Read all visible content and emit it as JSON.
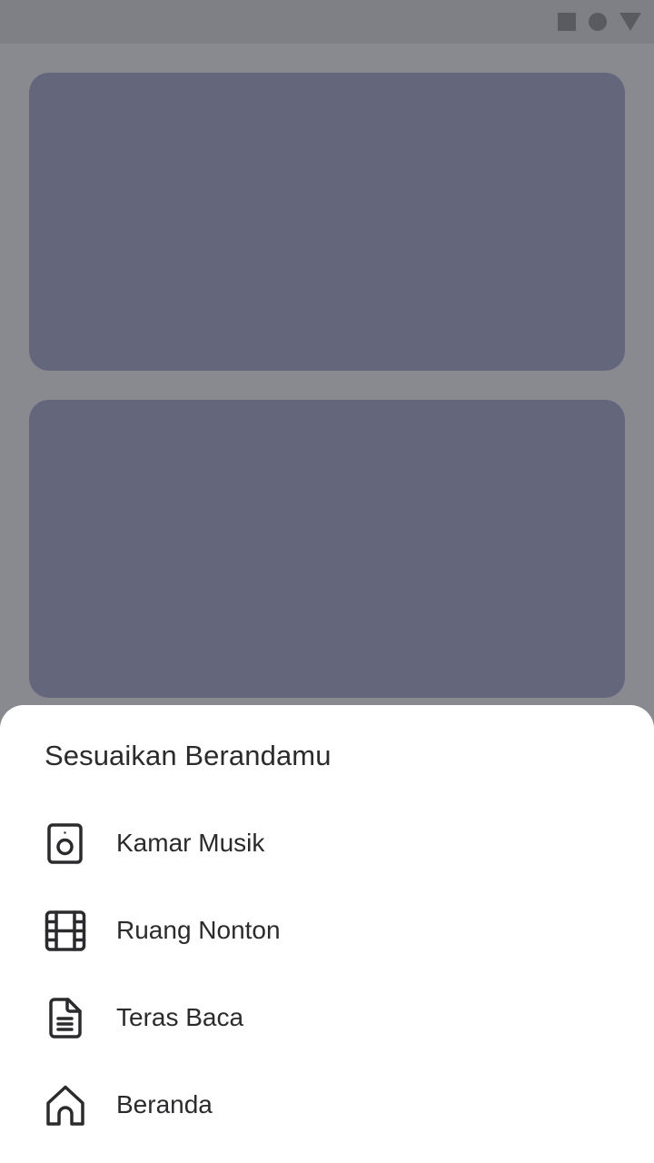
{
  "sheet": {
    "title": "Sesuaikan Berandamu",
    "items": [
      {
        "label": "Kamar Musik",
        "icon": "speaker-icon"
      },
      {
        "label": "Ruang Nonton",
        "icon": "film-icon"
      },
      {
        "label": "Teras Baca",
        "icon": "document-icon"
      },
      {
        "label": "Beranda",
        "icon": "home-icon"
      }
    ]
  },
  "colors": {
    "scrim_background": "#898a90",
    "status_bar": "#7f8086",
    "card_placeholder": "#64677b",
    "sheet_background": "#ffffff",
    "text": "#2b2b2e"
  }
}
